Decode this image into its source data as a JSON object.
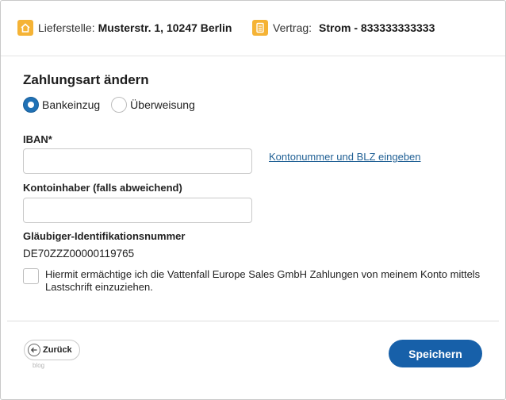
{
  "header": {
    "delivery": {
      "icon": "house-icon",
      "label": "Lieferstelle:",
      "value": "Musterstr. 1, 10247 Berlin"
    },
    "contract": {
      "icon": "document-icon",
      "label": "Vertrag:",
      "value": "Strom - 833333333333"
    }
  },
  "form": {
    "title": "Zahlungsart ändern",
    "payment_methods": [
      {
        "label": "Bankeinzug",
        "selected": true
      },
      {
        "label": "Überweisung",
        "selected": false
      }
    ],
    "iban": {
      "label": "IBAN*",
      "value": "",
      "placeholder": ""
    },
    "account_link": "Kontonummer und BLZ eingeben",
    "holder": {
      "label": "Kontoinhaber (falls abweichend)",
      "value": "",
      "placeholder": ""
    },
    "creditor": {
      "label": "Gläubiger-Identifikationsnummer",
      "value": "DE70ZZZ00000119765"
    },
    "consent": {
      "checked": false,
      "text": "Hiermit ermächtige ich die Vattenfall Europe Sales GmbH Zahlungen von meinem Konto mittels Lastschrift einzuziehen."
    }
  },
  "footer": {
    "back_label": "Zurück",
    "back_sub": "blog",
    "save_label": "Speichern"
  },
  "colors": {
    "accent": "#1760a9",
    "icon": "#f5b335",
    "link": "#1f5f94"
  }
}
